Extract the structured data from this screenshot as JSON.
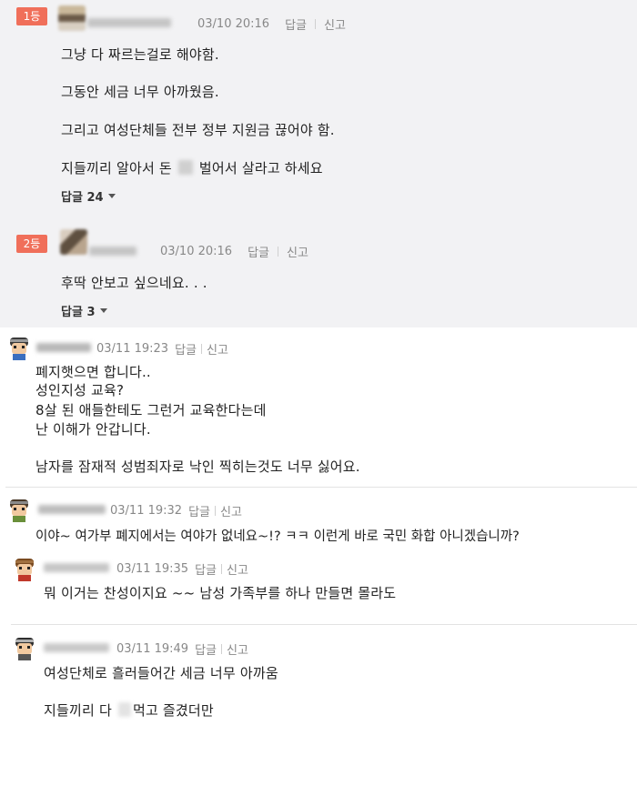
{
  "best_comments": [
    {
      "rank": "1등",
      "date": "03/10 20:16",
      "reply_label": "답글",
      "report_label": "신고",
      "lines": [
        "그냥 다 짜르는걸로 해야함.",
        "그동안 세금 너무 아까웠음.",
        "그리고 여성단체들 전부 정부 지원금 끊어야 함.",
        "지들끼리 알아서 돈",
        "벌어서 살라고 하세요"
      ],
      "reply_toggle": "답글 24"
    },
    {
      "rank": "2등",
      "date": "03/10 20:16",
      "reply_label": "답글",
      "report_label": "신고",
      "lines": [
        "후딱 안보고 싶으네요. . ."
      ],
      "reply_toggle": "답글 3"
    }
  ],
  "comments": [
    {
      "date": "03/11 19:23",
      "reply_label": "답글",
      "report_label": "신고",
      "lines": [
        "폐지햇으면 합니다..",
        "성인지성 교육?",
        "8살 된 애들한테도 그런거 교육한다는데",
        "난 이해가 안갑니다.",
        "남자를 잠재적 성범죄자로 낙인 찍히는것도 너무 싫어요."
      ]
    },
    {
      "date": "03/11 19:32",
      "reply_label": "답글",
      "report_label": "신고",
      "lines": [
        "이야~ 여가부 폐지에서는 여야가 없네요~!? ㅋㅋ 이런게 바로 국민 화합 아니겠습니까?"
      ]
    },
    {
      "date": "03/11 19:35",
      "reply_label": "답글",
      "report_label": "신고",
      "lines": [
        "뭐 이거는 찬성이지요 ~~ 남성 가족부를 하나 만들면 몰라도"
      ]
    },
    {
      "date": "03/11 19:49",
      "reply_label": "답글",
      "report_label": "신고",
      "lines": [
        "여성단체로 흘러들어간 세금 너무 아까움",
        "지들끼리 다",
        "먹고 즐겼더만"
      ]
    }
  ],
  "colors": {
    "badge": "#f06f5a",
    "best_bg": "#f2f2f4",
    "meta": "#888888"
  },
  "icons": {
    "character_avatar": "game-character-avatar-icon",
    "expand": "triangle-down-icon"
  }
}
